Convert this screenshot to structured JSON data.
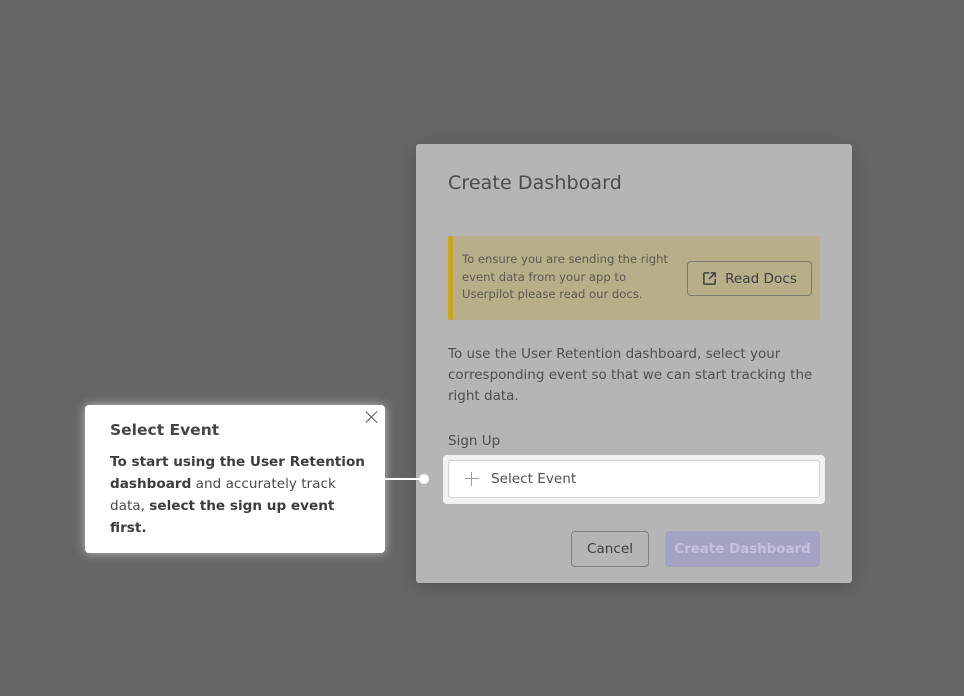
{
  "modal": {
    "title": "Create Dashboard",
    "notice": {
      "text": "To ensure you are sending the right event data from your app to Userpilot please read our docs.",
      "button_label": "Read Docs",
      "button_icon": "external-link-icon",
      "accent_color": "#c9a422"
    },
    "description": "To use the User Retention dashboard, select your corresponding event so that we can start tracking the right data.",
    "field_label": "Sign Up",
    "select": {
      "placeholder": "Select Event",
      "icon": "plus-icon"
    },
    "buttons": {
      "cancel": "Cancel",
      "create": "Create Dashboard"
    }
  },
  "tooltip": {
    "title": "Select Event",
    "body_part1": "To start using the User Retention dashboard",
    "body_part2": " and accurately track data, ",
    "body_part3": "select the sign up event first.",
    "close_icon": "close-icon"
  },
  "colors": {
    "overlay": "#666666",
    "primary_disabled": "#a5a3c4"
  }
}
